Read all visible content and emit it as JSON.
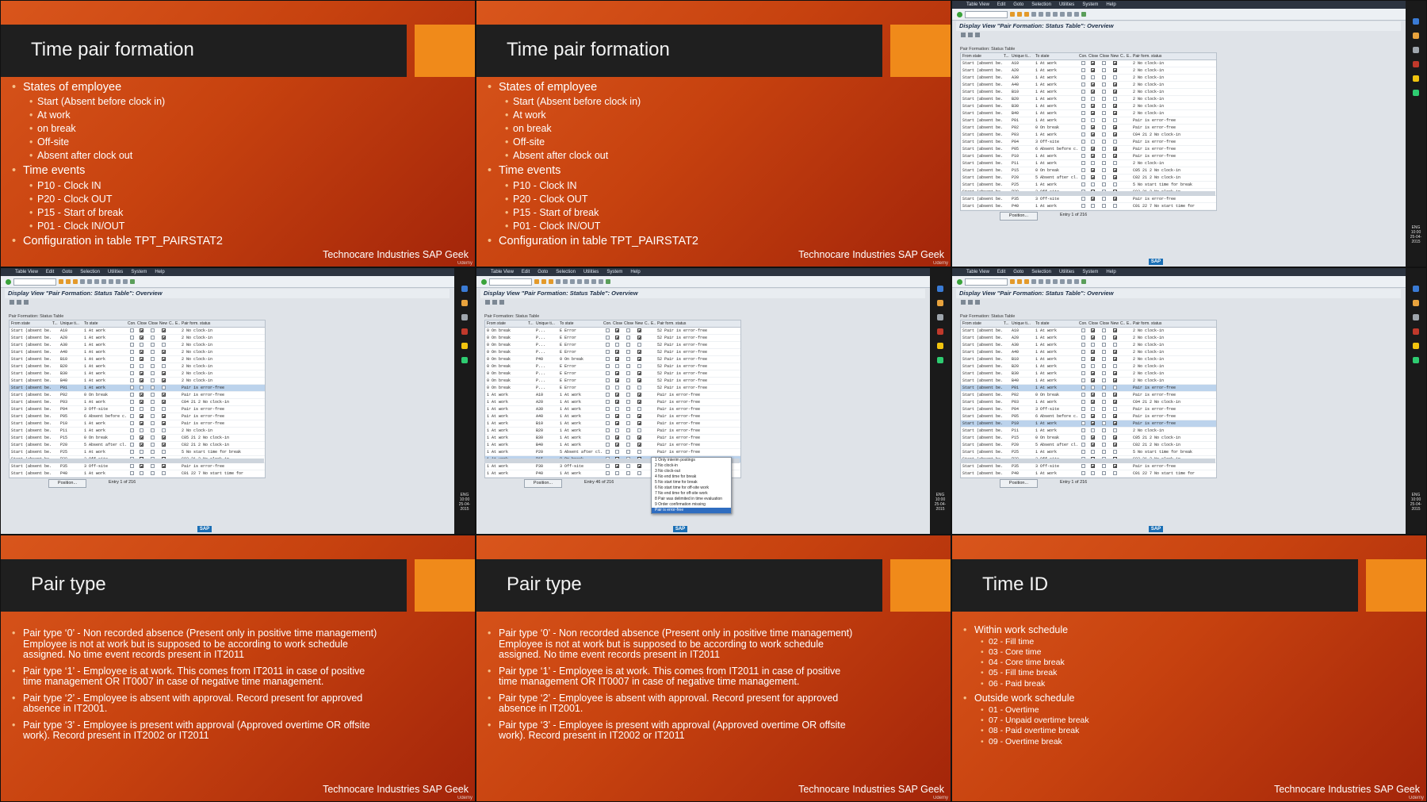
{
  "footer_brand": "Technocare Industries SAP Geek",
  "udemy": "Udemy",
  "slide1": {
    "title": "Time pair formation",
    "states_heading": "States of employee",
    "states": [
      "Start (Absent before clock in)",
      "At work",
      "on break",
      "Off-site",
      "Absent after clock out"
    ],
    "events_heading": "Time events",
    "events": [
      "P10 - Clock IN",
      "P20 - Clock OUT",
      "P15 - Start of break",
      "P01 - Clock IN/OUT"
    ],
    "config": "Configuration in table TPT_PAIRSTAT2"
  },
  "pairtype": {
    "title": "Pair type",
    "items": [
      "Pair type ‘0’ - Non recorded absence (Present only in positive time management) Employee is not at work but is supposed to be according to work schedule assigned. No time event records present in IT2011",
      "Pair type ‘1’ - Employee is at work. This comes from IT2011 in case of positive time management OR IT0007 in case of negative time management.",
      "Pair type ‘2’ - Employee is absent with approval. Record present for approved absence in IT2001.",
      "Pair type ‘3’ - Employee is present with approval (Approved overtime OR offsite work). Record present in IT2002 or IT2011"
    ]
  },
  "timeid": {
    "title": "Time ID",
    "within_heading": "Within work schedule",
    "within": [
      "02 - Fill time",
      "03 - Core time",
      "04 - Core time break",
      "05 - Fill time break",
      "06 - Paid break"
    ],
    "outside_heading": "Outside work schedule",
    "outside": [
      "01 - Overtime",
      "07 - Unpaid overtime break",
      "08 - Paid overtime break",
      "09 - Overtime break"
    ]
  },
  "sap": {
    "menu": [
      "Table View",
      "Edit",
      "Goto",
      "Selection",
      "Utilities",
      "System",
      "Help"
    ],
    "title": "Display View \"Pair Formation: Status Table\": Overview",
    "section": "Pair Formation: Status Table",
    "cols": [
      "From state",
      "T...",
      "Unique ti...",
      "To state",
      "Con...",
      "Closed",
      "Close",
      "New",
      "C...",
      "E...",
      "Pair form. status"
    ],
    "position": "Position...",
    "entry1": "Entry 1 of 216",
    "entry46": "Entry 46 of 216",
    "lang": "ENG",
    "date": "25-04-2015",
    "time": "10:00",
    "logo": "SAP",
    "rows_start": [
      [
        "Start (absent be...",
        "A10",
        "1 At work",
        "2 No clock-in"
      ],
      [
        "Start (absent be...",
        "A20",
        "1 At work",
        "2 No clock-in"
      ],
      [
        "Start (absent be...",
        "A30",
        "1 At work",
        "2 No clock-in"
      ],
      [
        "Start (absent be...",
        "A40",
        "1 At work",
        "2 No clock-in"
      ],
      [
        "Start (absent be...",
        "B10",
        "1 At work",
        "2 No clock-in"
      ],
      [
        "Start (absent be...",
        "B20",
        "1 At work",
        "2 No clock-in"
      ],
      [
        "Start (absent be...",
        "B30",
        "1 At work",
        "2 No clock-in"
      ],
      [
        "Start (absent be...",
        "B40",
        "1 At work",
        "2 No clock-in"
      ],
      [
        "Start (absent be...",
        "P01",
        "1 At work",
        "Pair is error-free"
      ],
      [
        "Start (absent be...",
        "P02",
        "0 On break",
        "Pair is error-free"
      ],
      [
        "Start (absent be...",
        "P03",
        "1 At work",
        "C04 21 2 No clock-in"
      ],
      [
        "Start (absent be...",
        "P04",
        "3 Off-site",
        "Pair is error-free"
      ],
      [
        "Start (absent be...",
        "P05",
        "6 Absent before c...",
        "Pair is error-free"
      ],
      [
        "Start (absent be...",
        "P10",
        "1 At work",
        "Pair is error-free"
      ],
      [
        "Start (absent be...",
        "P11",
        "1 At work",
        "2 No clock-in"
      ],
      [
        "Start (absent be...",
        "P15",
        "0 On break",
        "C05 21 2 No clock-in"
      ],
      [
        "Start (absent be...",
        "P20",
        "5 Absent after cl...",
        "C02 21 2 No clock-in"
      ],
      [
        "Start (absent be...",
        "P25",
        "1 At work",
        "5 No start time for break"
      ],
      [
        "Start (absent be...",
        "P30",
        "3 Off-site",
        "C03 21 2 No clock-in"
      ],
      [
        "Start (absent be...",
        "P35",
        "3 Off-site",
        "Pair is error-free"
      ],
      [
        "Start (absent be...",
        "P40",
        "1 At work",
        "C01 22 7 No start time for off-"
      ]
    ],
    "rows_break": [
      [
        "0 On break",
        "P...",
        "E Error",
        "52 Pair is error-free"
      ],
      [
        "0 On break",
        "P...",
        "E Error",
        "52 Pair is error-free"
      ],
      [
        "0 On break",
        "P...",
        "E Error",
        "52 Pair is error-free"
      ],
      [
        "0 On break",
        "P...",
        "E Error",
        "52 Pair is error-free"
      ],
      [
        "0 On break",
        "P40",
        "0 On break",
        "52 Pair is error-free"
      ],
      [
        "0 On break",
        "P...",
        "E Error",
        "52 Pair is error-free"
      ],
      [
        "0 On break",
        "P...",
        "E Error",
        "52 Pair is error-free"
      ],
      [
        "0 On break",
        "P...",
        "E Error",
        "52 Pair is error-free"
      ],
      [
        "0 On break",
        "P...",
        "E Error",
        "52 Pair is error-free"
      ],
      [
        "1 At work",
        "A10",
        "1 At work",
        "Pair is error-free"
      ],
      [
        "1 At work",
        "A20",
        "1 At work",
        "Pair is error-free"
      ],
      [
        "1 At work",
        "A30",
        "1 At work",
        "Pair is error-free"
      ],
      [
        "1 At work",
        "A40",
        "1 At work",
        "Pair is error-free"
      ],
      [
        "1 At work",
        "B10",
        "1 At work",
        "Pair is error-free"
      ],
      [
        "1 At work",
        "B20",
        "1 At work",
        "Pair is error-free"
      ],
      [
        "1 At work",
        "B30",
        "1 At work",
        "Pair is error-free"
      ],
      [
        "1 At work",
        "B40",
        "1 At work",
        "Pair is error-free"
      ],
      [
        "1 At work",
        "P20",
        "5 Absent after cl...",
        "Pair is error-free"
      ],
      [
        "1 At work",
        "P15",
        "0 On break",
        "Pair is error-free"
      ],
      [
        "1 At work",
        "P30",
        "3 Off-site",
        "Pair is error-free"
      ],
      [
        "1 At work",
        "P40",
        "1 At work",
        "Pair is error-free"
      ]
    ],
    "dropdown": [
      "1 Only interim postings",
      "2 No clock-in",
      "3 No clock-out",
      "4 No end time for break",
      "5 No start time for break",
      "6 No start time for off-site work",
      "7 No end time for off-site work",
      "8 Pair was delimited in time evaluation",
      "9 Order confirmation missing",
      "Pair is error-free"
    ]
  }
}
